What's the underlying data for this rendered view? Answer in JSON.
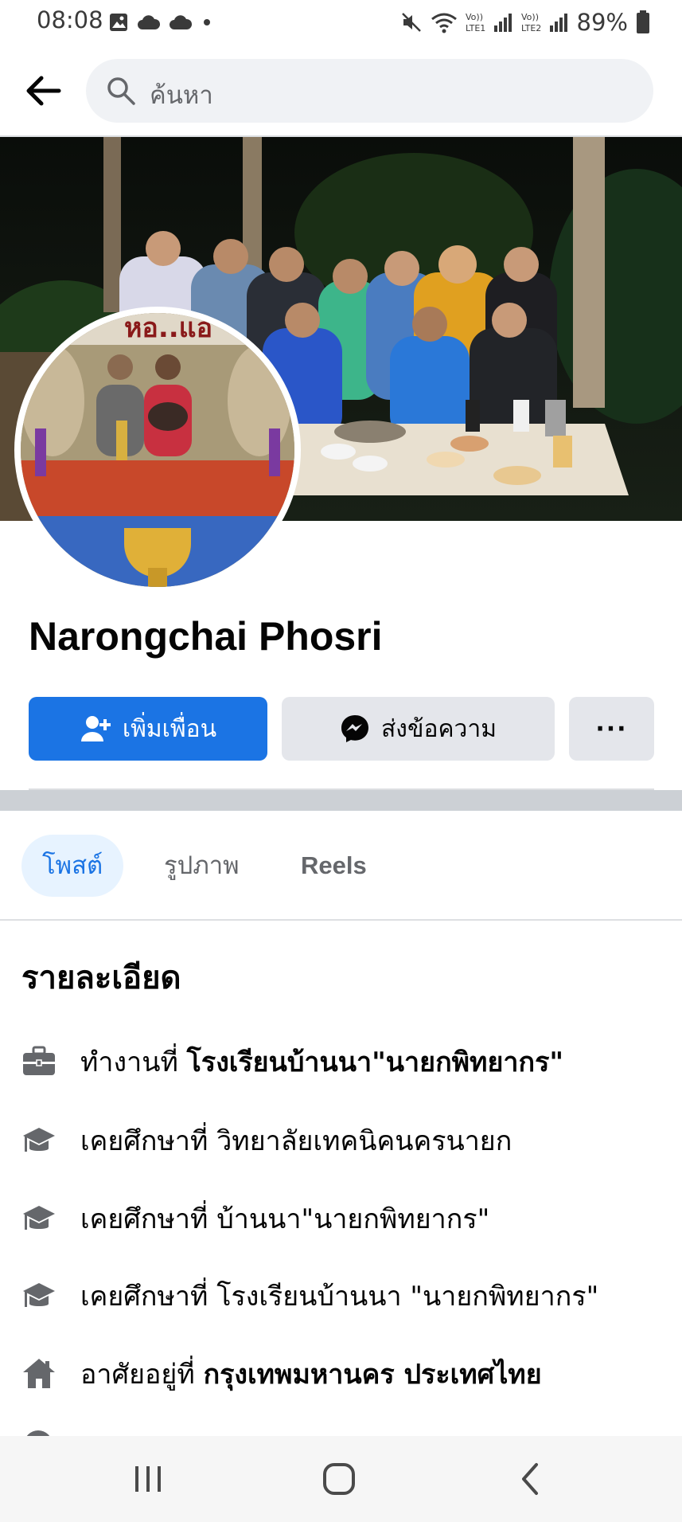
{
  "status_bar": {
    "time": "08:08",
    "battery": "89%",
    "icons": [
      "gallery-icon",
      "cloud-icon",
      "cloud-icon",
      "dot-icon",
      "mute-icon",
      "wifi-icon",
      "lte1-signal-icon",
      "lte2-signal-icon",
      "battery-icon"
    ],
    "lte1_label": "Vo)) LTE1",
    "lte2_label": "Vo)) LTE2"
  },
  "header": {
    "search_placeholder": "ค้นหา"
  },
  "profile": {
    "name": "Narongchai Phosri",
    "add_friend_label": "เพิ่มเพื่อน",
    "message_label": "ส่งข้อความ",
    "more_label": "···"
  },
  "tabs": [
    {
      "label": "โพสต์",
      "active": true
    },
    {
      "label": "รูปภาพ",
      "active": false
    },
    {
      "label": "Reels",
      "active": false
    }
  ],
  "details": {
    "title": "รายละเอียด",
    "items": [
      {
        "icon": "briefcase-icon",
        "prefix": "ทำงานที่ ",
        "value": "โรงเรียนบ้านนา\"นายกพิทยากร\"",
        "bold": true
      },
      {
        "icon": "graduation-cap-icon",
        "prefix": "เคยศึกษาที่ ",
        "value": "วิทยาลัยเทคนิคนครนายก",
        "bold": false
      },
      {
        "icon": "graduation-cap-icon",
        "prefix": "เคยศึกษาที่ ",
        "value": "บ้านนา\"นายกพิทยากร\"",
        "bold": false
      },
      {
        "icon": "graduation-cap-icon",
        "prefix": "เคยศึกษาที่ ",
        "value": "โรงเรียนบ้านนา \"นายกพิทยากร\"",
        "bold": false
      },
      {
        "icon": "home-icon",
        "prefix": "อาศัยอยู่ที่ ",
        "value": "กรุงเทพมหานคร ประเทศไทย",
        "bold": true
      }
    ]
  },
  "colors": {
    "accent": "#1b74e4",
    "secondary_button": "#e4e6eb",
    "search_bg": "#f0f2f5",
    "muted_text": "#65676b"
  },
  "nav_bar": {
    "icons": [
      "recent-apps-icon",
      "home-nav-icon",
      "back-nav-icon"
    ]
  }
}
